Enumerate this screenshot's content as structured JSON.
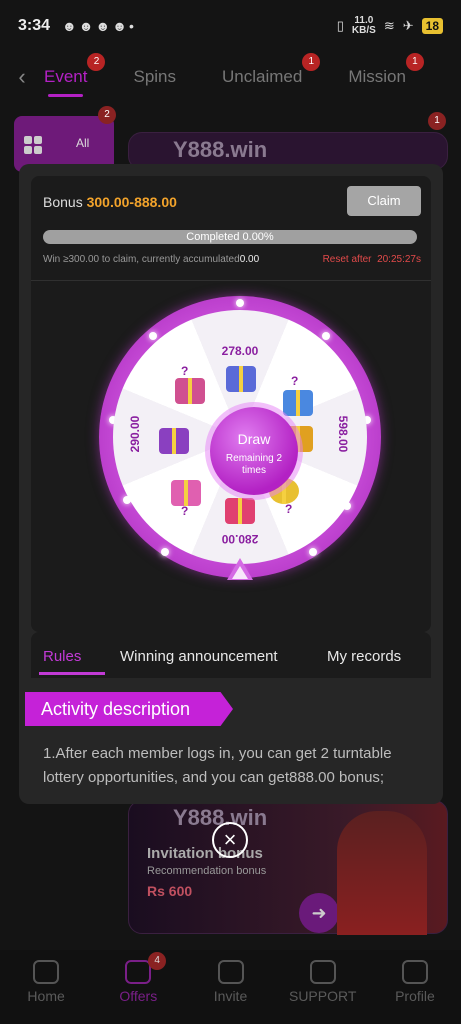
{
  "status_bar": {
    "time": "3:34",
    "speed_top": "11.0",
    "speed_bottom": "KB/S",
    "battery": "18"
  },
  "tabs": [
    {
      "label": "Event",
      "badge": "2",
      "active": true
    },
    {
      "label": "Spins",
      "badge": ""
    },
    {
      "label": "Unclaimed",
      "badge": "1"
    },
    {
      "label": "Mission",
      "badge": "1"
    }
  ],
  "background": {
    "category_all": "All",
    "category_badge": "2",
    "card_badge": "1",
    "brand": "Y888.win",
    "invite_title": "Invitation bonus",
    "invite_sub": "Recommendation bonus",
    "invite_amount": "Rs 600"
  },
  "modal": {
    "bonus_label": "Bonus",
    "bonus_range": "300.00-888.00",
    "claim_label": "Claim",
    "progress_text": "Completed 0.00%",
    "progress_fraction": 0,
    "win_info": "Win ≥300.00 to claim, currently accumulated",
    "accumulated": "0.00",
    "reset_label": "Reset after",
    "reset_time": "20:25:27s",
    "wheel": {
      "prizes": [
        "278.00",
        "598.00",
        "280.00",
        "290.00"
      ],
      "mystery": "?",
      "draw_label": "Draw",
      "remaining": "Remaining 2 times"
    },
    "rule_tabs": [
      "Rules",
      "Winning announcement",
      "My records"
    ],
    "section_title": "Activity description",
    "description": "1.After each member logs in, you can get 2 turntable lottery opportunities, and you can get888.00 bonus;"
  },
  "nav": [
    {
      "label": "Home",
      "icon": "home-icon"
    },
    {
      "label": "Offers",
      "icon": "gift-icon",
      "badge": "4",
      "active": true
    },
    {
      "label": "Invite",
      "icon": "people-icon"
    },
    {
      "label": "SUPPORT",
      "icon": "headset-icon"
    },
    {
      "label": "Profile",
      "icon": "person-icon"
    }
  ]
}
